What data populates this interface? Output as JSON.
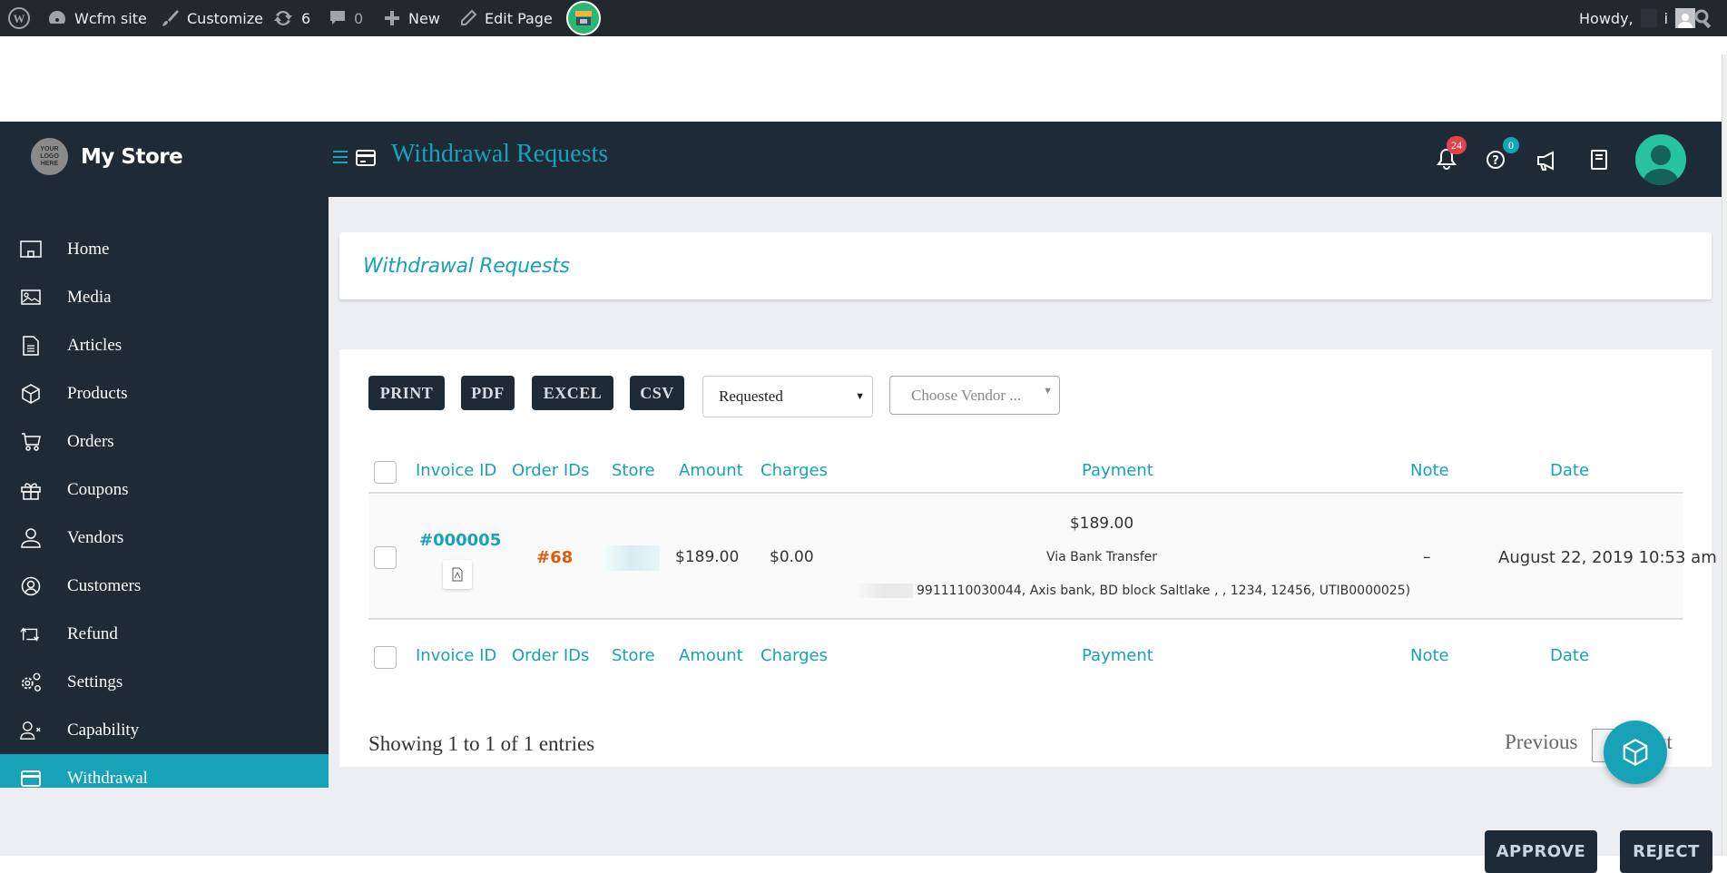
{
  "adminbar": {
    "site_name": "Wcfm site",
    "customize": "Customize",
    "updates_count": "6",
    "comments_count": "0",
    "new_label": "New",
    "edit_page": "Edit Page",
    "howdy": "Howdy,",
    "user_initial": "i"
  },
  "header": {
    "store_name": "My Store",
    "logo_text": "YOUR LOGO HERE",
    "page_title": "Withdrawal Requests",
    "notifications_count": "24",
    "help_count": "0"
  },
  "sidebar": {
    "items": [
      {
        "label": "Home",
        "icon": "home-icon"
      },
      {
        "label": "Media",
        "icon": "media-icon"
      },
      {
        "label": "Articles",
        "icon": "article-icon"
      },
      {
        "label": "Products",
        "icon": "cube-icon"
      },
      {
        "label": "Orders",
        "icon": "cart-icon"
      },
      {
        "label": "Coupons",
        "icon": "gift-icon"
      },
      {
        "label": "Vendors",
        "icon": "user-icon"
      },
      {
        "label": "Customers",
        "icon": "user-circle-icon"
      },
      {
        "label": "Refund",
        "icon": "refund-icon"
      },
      {
        "label": "Settings",
        "icon": "gears-icon"
      },
      {
        "label": "Capability",
        "icon": "user-x-icon"
      },
      {
        "label": "Withdrawal",
        "icon": "card-icon",
        "active": true
      }
    ]
  },
  "main": {
    "card_title": "Withdrawal Requests",
    "export_buttons": [
      "PRINT",
      "PDF",
      "EXCEL",
      "CSV"
    ],
    "status_select": "Requested",
    "vendor_placeholder": "Choose Vendor ...",
    "columns": [
      "Invoice ID",
      "Order IDs",
      "Store",
      "Amount",
      "Charges",
      "Payment",
      "Note",
      "Date"
    ],
    "rows": [
      {
        "invoice_id": "#000005",
        "order_ids": "#68",
        "store": "",
        "amount": "$189.00",
        "charges": "$0.00",
        "payment_amount": "$189.00",
        "payment_method": "Via Bank Transfer",
        "payment_details": "9911110030044, Axis bank, BD block Saltlake , , 1234, 12456, UTIB0000025)",
        "note": "–",
        "date": "August 22, 2019 10:53 am"
      }
    ],
    "showing": "Showing 1 to 1 of 1 entries",
    "previous": "Previous",
    "next": "Next",
    "approve": "APPROVE",
    "reject": "REJECT"
  },
  "colors": {
    "accent": "#17a2b8",
    "dark": "#1e2a36",
    "order_link": "#e05a10",
    "badge_red": "#e2434b"
  }
}
